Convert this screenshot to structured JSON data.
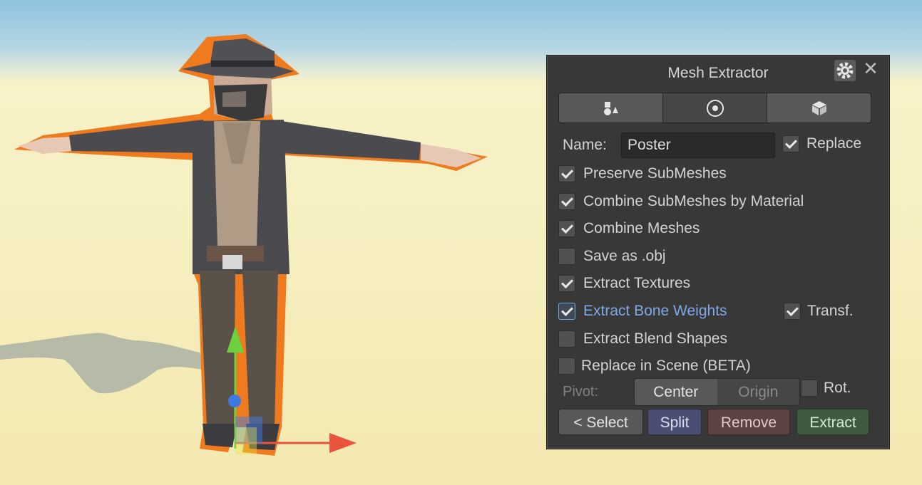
{
  "window": {
    "title": "Mesh Extractor",
    "close_label": "✕"
  },
  "tabs": [
    {
      "icon": "shapes-icon"
    },
    {
      "icon": "target-icon"
    },
    {
      "icon": "cube-icon"
    }
  ],
  "name": {
    "label": "Name:",
    "value": "Poster",
    "replace_label": "Replace",
    "replace_checked": true
  },
  "options": [
    {
      "label": "Preserve SubMeshes",
      "checked": true
    },
    {
      "label": "Combine SubMeshes by Material",
      "checked": true
    },
    {
      "label": "Combine Meshes",
      "checked": true
    },
    {
      "label": "Save as .obj",
      "checked": false
    },
    {
      "label": "Extract Textures",
      "checked": true
    },
    {
      "label": "Extract Bone Weights",
      "checked": true,
      "focused": true
    },
    {
      "label": "Extract Blend Shapes",
      "checked": false
    },
    {
      "label": "Replace in Scene (BETA)",
      "checked": false
    }
  ],
  "transf": {
    "label": "Transf.",
    "checked": true
  },
  "pivot": {
    "label": "Pivot:",
    "options": [
      "Center",
      "Origin"
    ],
    "selected": "Center"
  },
  "rot": {
    "label": "Rot.",
    "checked": false
  },
  "buttons": {
    "select": "< Select",
    "split": "Split",
    "remove": "Remove",
    "extract": "Extract"
  },
  "colors": {
    "panel": "#383838",
    "split": "#4a4e73",
    "remove": "#5c4242",
    "extract": "#3f5a3f",
    "focus": "#7ea9e8",
    "outline": "#f07a1e"
  }
}
